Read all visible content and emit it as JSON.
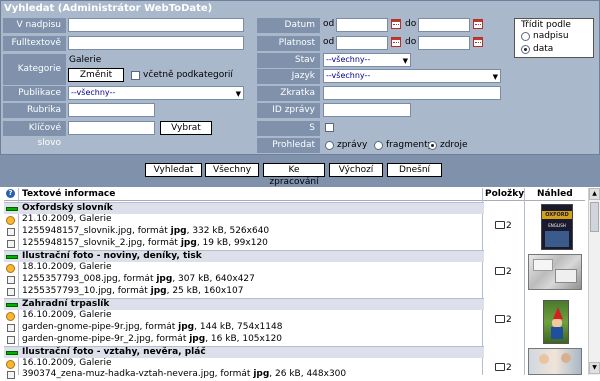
{
  "title": "Vyhledat (Administrátor WebToDate)",
  "labels": {
    "nadpis": "V nadpisu",
    "fulltext": "Fulltextově",
    "kategorie": "Kategorie",
    "publikace": "Publikace",
    "rubrika": "Rubrika",
    "klicove": "Klíčové slovo",
    "datum": "Datum",
    "platnost": "Platnost",
    "stav": "Stav",
    "jazyk": "Jazyk",
    "zkratka": "Zkratka",
    "id": "ID zprávy",
    "poznamka": "S poznámkou",
    "prohledat": "Prohledat"
  },
  "kategorie_value": "Galerie",
  "zmenit_label": "Změnit",
  "vcetne_label": "včetně podkategorií",
  "vybrat_label": "Vybrat",
  "od": "od",
  "do": "do",
  "vsechny_option": "--všechny--",
  "trideni": {
    "title": "Třídit podle",
    "opt1": "nadpisu",
    "opt2": "data"
  },
  "prohledat_opts": {
    "a": "zprávy",
    "b": "fragmenty",
    "c": "zdroje"
  },
  "actions": {
    "vyhledat": "Vyhledat",
    "vsechny": "Všechny",
    "kezpracovani": "Ke zpracování",
    "vychozi": "Výchozí",
    "dnesni": "Dnešní"
  },
  "table": {
    "help": "?",
    "col_info": "Textové informace",
    "col_polozky": "Položky",
    "col_nahled": "Náhled"
  },
  "records": [
    {
      "title": "Oxfordský slovník",
      "meta": "21.10.2009, Galerie",
      "files": [
        {
          "name": "1255948157_slovnik.jpg, formát ",
          "fmt": "jpg",
          "rest": ", 332 kB, 526x640"
        },
        {
          "name": "1255948157_slovnik_2.jpg, formát ",
          "fmt": "jpg",
          "rest": ", 19 kB, 99x120"
        }
      ],
      "count": "2",
      "thumb_title": "OXFORD",
      "thumb_sub": "ENGLISH"
    },
    {
      "title": "Ilustrační foto - noviny, deníky, tisk",
      "meta": "18.10.2009, Galerie",
      "files": [
        {
          "name": "1255357793_008.jpg, formát ",
          "fmt": "jpg",
          "rest": ", 307 kB, 640x427"
        },
        {
          "name": "1255357793_10.jpg, formát ",
          "fmt": "jpg",
          "rest": ", 25 kB, 160x107"
        }
      ],
      "count": "2"
    },
    {
      "title": "Zahradní trpaslík",
      "meta": "16.10.2009, Galerie",
      "files": [
        {
          "name": "garden-gnome-pipe-9r.jpg, formát ",
          "fmt": "jpg",
          "rest": ", 144 kB, 754x1148"
        },
        {
          "name": "garden-gnome-pipe-9r_2.jpg, formát ",
          "fmt": "jpg",
          "rest": ", 16 kB, 105x120"
        }
      ],
      "count": "2"
    },
    {
      "title": "Ilustrační foto - vztahy, nevěra, pláč",
      "meta": "16.10.2009, Galerie",
      "files": [
        {
          "name": "390374_zena-muz-hadka-vztah-nevera.jpg, formát ",
          "fmt": "jpg",
          "rest": ", 26 kB, 448x300"
        }
      ],
      "count": "2"
    }
  ]
}
